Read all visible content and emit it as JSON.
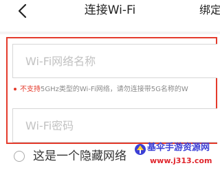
{
  "header": {
    "back_icon": "chevron-left-icon",
    "title": "连接Wi-Fi",
    "right_link": "绑定"
  },
  "form": {
    "ssid_placeholder": "Wi-Fi网络名称",
    "ssid_value": "",
    "note_warn": "不支持",
    "note_rest": "5GHz类型的Wi-Fi网络，请勿连接带5G名称的W",
    "password_placeholder": "Wi-Fi密码",
    "password_value": "",
    "hidden_network_label": "这是一个隐藏网络"
  },
  "watermark": {
    "title": "基伞手游资源网",
    "url": "www.j313.com"
  },
  "colors": {
    "accent": "#e43a2b",
    "watermark_blue": "#3b3fd6",
    "watermark_red": "#e0262d"
  }
}
